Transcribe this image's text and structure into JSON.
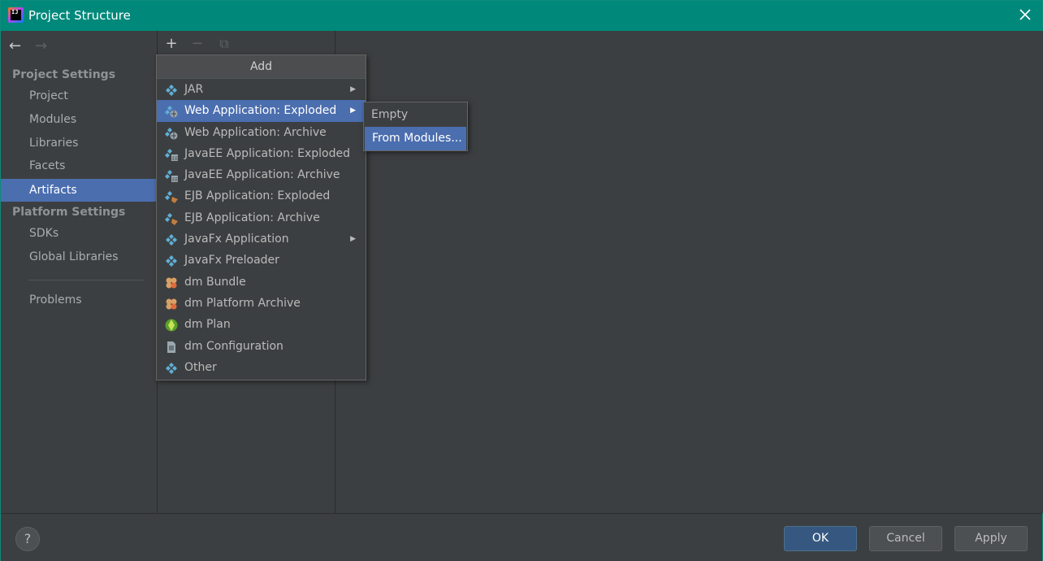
{
  "window": {
    "title": "Project Structure"
  },
  "nav": {
    "back": "←",
    "forward": "→"
  },
  "sidebar": {
    "project_settings_title": "Project Settings",
    "project_items": [
      "Project",
      "Modules",
      "Libraries",
      "Facets",
      "Artifacts"
    ],
    "selected": "Artifacts",
    "platform_settings_title": "Platform Settings",
    "platform_items": [
      "SDKs",
      "Global Libraries"
    ],
    "problems": "Problems"
  },
  "toolbar": {
    "add": "+",
    "remove": "−",
    "copy": "⧉"
  },
  "add_popup": {
    "title": "Add",
    "items": [
      {
        "label": "JAR",
        "icon": "artifact-icon",
        "submenu": true
      },
      {
        "label": "Web Application: Exploded",
        "icon": "web-app-icon",
        "submenu": true,
        "active": true
      },
      {
        "label": "Web Application: Archive",
        "icon": "web-app-icon"
      },
      {
        "label": "JavaEE Application: Exploded",
        "icon": "javaee-icon"
      },
      {
        "label": "JavaEE Application: Archive",
        "icon": "javaee-icon"
      },
      {
        "label": "EJB Application: Exploded",
        "icon": "ejb-icon"
      },
      {
        "label": "EJB Application: Archive",
        "icon": "ejb-icon"
      },
      {
        "label": "JavaFx Application",
        "icon": "artifact-icon",
        "submenu": true
      },
      {
        "label": "JavaFx Preloader",
        "icon": "artifact-icon"
      },
      {
        "label": "dm Bundle",
        "icon": "bundle-icon"
      },
      {
        "label": "dm Platform Archive",
        "icon": "bundle-icon"
      },
      {
        "label": "dm Plan",
        "icon": "plan-globe-icon"
      },
      {
        "label": "dm Configuration",
        "icon": "document-icon"
      },
      {
        "label": "Other",
        "icon": "artifact-icon"
      }
    ]
  },
  "submenu": {
    "items": [
      "Empty",
      "From Modules..."
    ],
    "active": "From Modules..."
  },
  "buttons": {
    "help": "?",
    "ok": "OK",
    "cancel": "Cancel",
    "apply": "Apply"
  },
  "colors": {
    "titlebar": "#00897b",
    "selection": "#4b6eaf",
    "background": "#3c3f41",
    "primary_button": "#365880"
  }
}
